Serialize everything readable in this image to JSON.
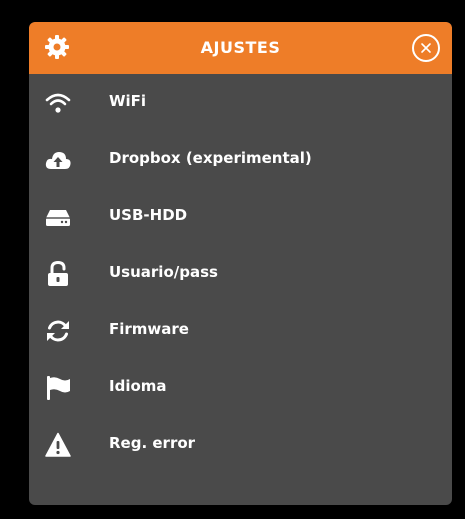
{
  "header": {
    "title": "AJUSTES",
    "icon": "gear-icon",
    "close_icon": "close-icon"
  },
  "menu": {
    "items": [
      {
        "label": "WiFi",
        "icon": "wifi-icon"
      },
      {
        "label": "Dropbox (experimental)",
        "icon": "cloud-upload-icon"
      },
      {
        "label": "USB-HDD",
        "icon": "hard-drive-icon"
      },
      {
        "label": "Usuario/pass",
        "icon": "unlock-icon"
      },
      {
        "label": "Firmware",
        "icon": "refresh-icon"
      },
      {
        "label": "Idioma",
        "icon": "flag-icon"
      },
      {
        "label": "Reg. error",
        "icon": "warning-icon"
      }
    ]
  },
  "colors": {
    "accent": "#ee7d28",
    "panel": "#4a4a4a",
    "background": "#000000",
    "text": "#ffffff"
  }
}
